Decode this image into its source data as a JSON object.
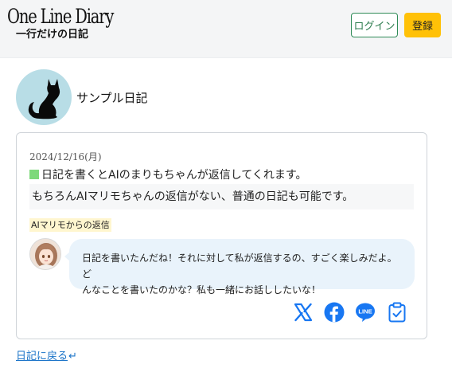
{
  "header": {
    "logo_main": "One Line Diary",
    "logo_sub": "一行だけの日記",
    "login_label": "ログイン",
    "register_label": "登録"
  },
  "profile": {
    "diary_name": "サンプル日記",
    "avatar_icon": "black-cat-silhouette"
  },
  "entry": {
    "date": "2024/12/16(月)",
    "line1": "日記を書くとAIのまりもちゃんが返信してくれます。",
    "line2": "もちろんAIマリモちゃんの返信がない、普通の日記も可能です。",
    "ai_label": "AIマリモからの返信",
    "ai_reply_line1": "日記を書いたんだね！それに対して私が返信するの、すごく楽しみだよ。ど",
    "ai_reply_line2": "んなことを書いたのかな？私も一緒にお話ししたいな！"
  },
  "share": {
    "icons": [
      "x-icon",
      "facebook-icon",
      "line-icon",
      "clipboard-icon"
    ],
    "colors": {
      "brand_blue": "#1877f2",
      "x": "#1877f2"
    }
  },
  "footer": {
    "back_label": "日記に戻る",
    "back_arrow": "↵"
  },
  "colors": {
    "login_border": "#2e8b57",
    "register_bg": "#ffc107",
    "bubble_bg": "#e9f3fb",
    "ai_label_bg": "#fff6cf",
    "accent_green": "#7dd97a",
    "link": "#1a73c8"
  }
}
